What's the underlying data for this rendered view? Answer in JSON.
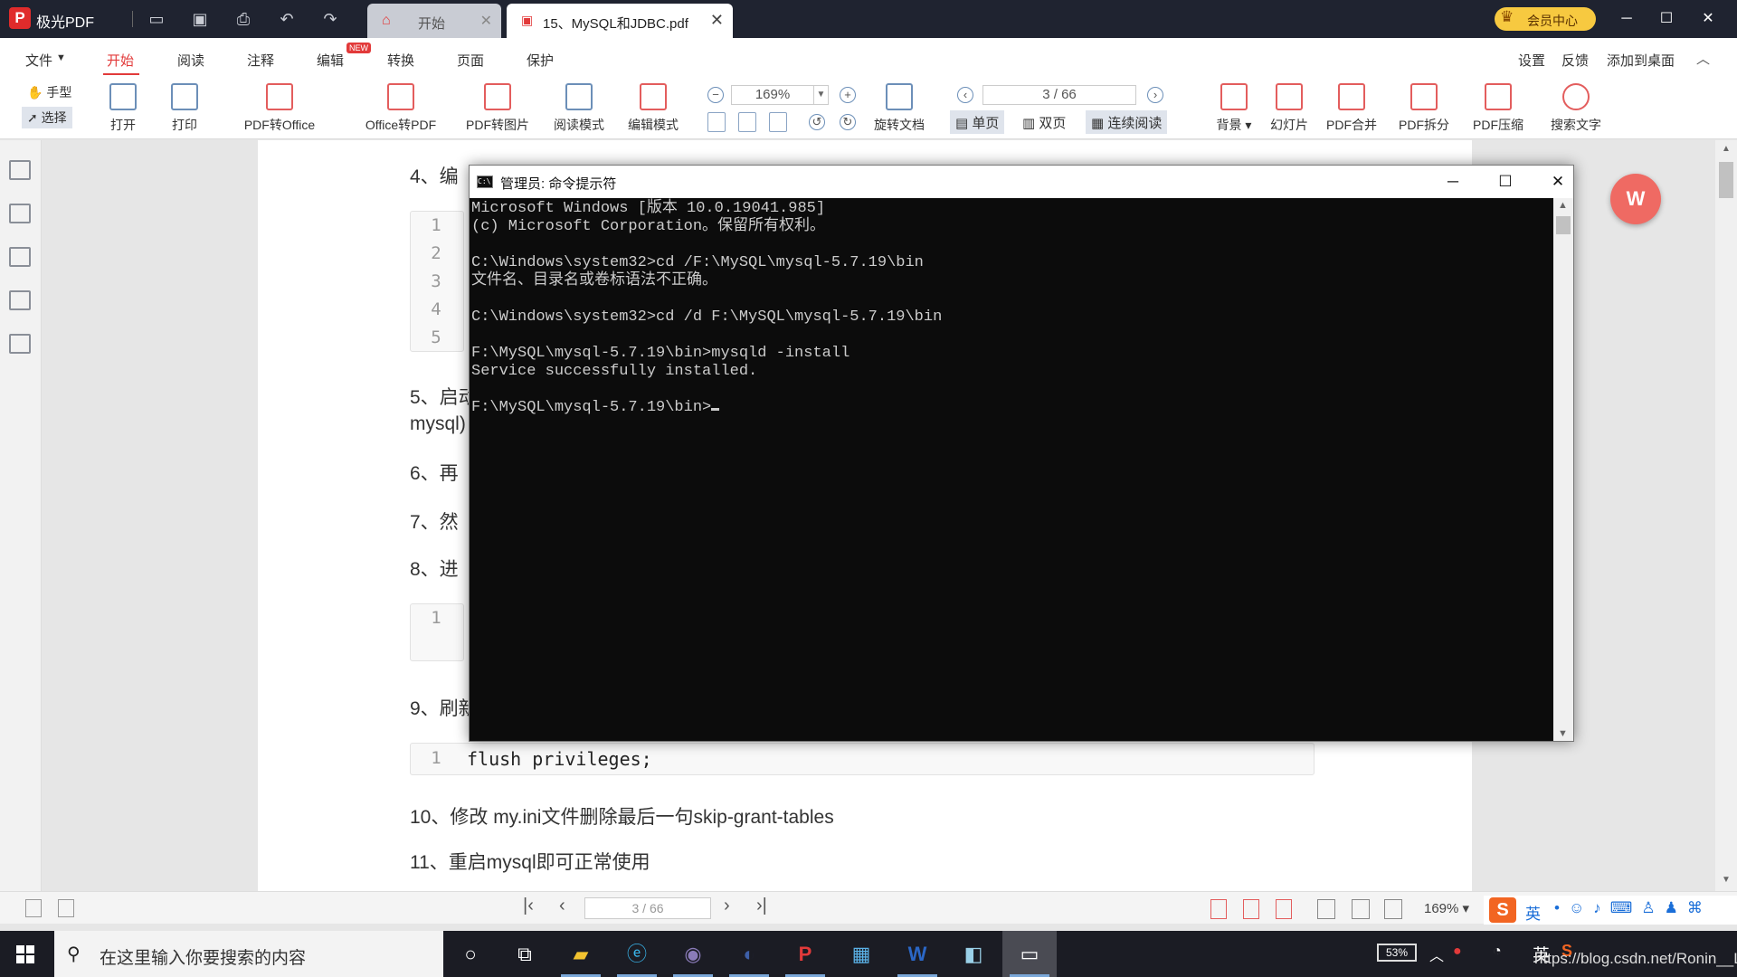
{
  "app": {
    "name": "极光PDF",
    "logo": "P"
  },
  "tabs": [
    {
      "label": "开始"
    },
    {
      "label": "15、MySQL和JDBC.pdf"
    }
  ],
  "vip": {
    "label": "会员中心"
  },
  "menu": {
    "items": [
      "文件",
      "开始",
      "阅读",
      "注释",
      "编辑",
      "转换",
      "页面",
      "保护"
    ],
    "new_badge": "NEW",
    "right": [
      "设置",
      "反馈",
      "添加到桌面"
    ]
  },
  "toolbar": {
    "hand": "手型",
    "select": "选择",
    "tools": [
      "打开",
      "打印",
      "PDF转Office",
      "Office转PDF",
      "PDF转图片",
      "阅读模式",
      "编辑模式"
    ],
    "zoom": "169%",
    "page": "3 / 66",
    "rotate": "旋转文档",
    "views": [
      "单页",
      "双页",
      "连续阅读"
    ],
    "right_tools": [
      "背景",
      "幻灯片",
      "PDF合并",
      "PDF拆分",
      "PDF压缩",
      "搜索文字"
    ]
  },
  "document": {
    "steps": [
      "4、编",
      "5、启动",
      "mysql)",
      "6、再",
      "7、然",
      "8、进",
      "9、刷新",
      "10、修改 my.ini文件删除最后一句skip-grant-tables",
      "11、重启mysql即可正常使用"
    ],
    "code_block_1_lines": [
      "1",
      "2",
      "3",
      "4",
      "5"
    ],
    "code_block_2_lines": [
      "1"
    ],
    "code_block_3": {
      "line": "1",
      "code": "flush privileges;"
    }
  },
  "cmd": {
    "title": "管理员: 命令提示符",
    "lines": [
      "Microsoft Windows [版本 10.0.19041.985]",
      "(c) Microsoft Corporation。保留所有权利。",
      "",
      "C:\\Windows\\system32>cd /F:\\MySQL\\mysql-5.7.19\\bin",
      "文件名、目录名或卷标语法不正确。",
      "",
      "C:\\Windows\\system32>cd /d F:\\MySQL\\mysql-5.7.19\\bin",
      "",
      "F:\\MySQL\\mysql-5.7.19\\bin>mysqld -install",
      "Service successfully installed.",
      "",
      "F:\\MySQL\\mysql-5.7.19\\bin>"
    ]
  },
  "statusbar": {
    "page": "3 / 66",
    "zoom": "169%"
  },
  "taskbar": {
    "search_placeholder": "在这里输入你要搜索的内容",
    "battery": "53%",
    "ime": "英",
    "watermark": "https://blog.csdn.net/Ronin__L"
  },
  "ime_bar": {
    "logo": "S",
    "lang": "英"
  },
  "colors": {
    "accent": "#e23a3a",
    "titlebar": "#1f2330",
    "taskbar": "#1b1c24",
    "console_bg": "#0c0c0c"
  }
}
